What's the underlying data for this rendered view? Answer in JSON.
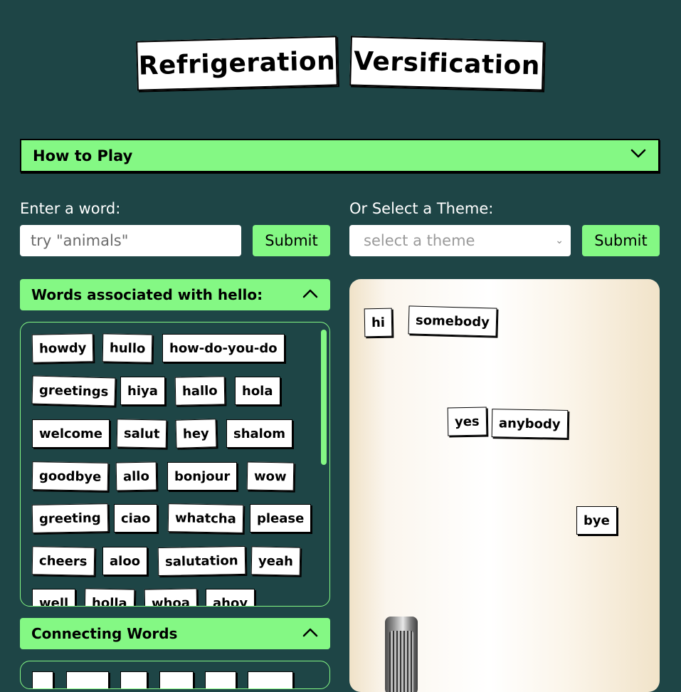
{
  "title": {
    "word1": "Refrigeration",
    "word2": "Versification"
  },
  "how_to_play": {
    "label": "How to Play",
    "icon": "chevron-down-icon"
  },
  "word_entry": {
    "label": "Enter a word:",
    "placeholder": "try \"animals\"",
    "submit": "Submit"
  },
  "theme_select": {
    "label": "Or Select a Theme:",
    "selected": "select a theme",
    "submit": "Submit"
  },
  "associated_panel": {
    "title": "Words associated with hello:",
    "icon": "chevron-up-icon",
    "words": [
      "howdy",
      "hullo",
      "how-do-you-do",
      "greetings",
      "hiya",
      "hallo",
      "hola",
      "welcome",
      "salut",
      "hey",
      "shalom",
      "goodbye",
      "allo",
      "bonjour",
      "wow",
      "greeting",
      "ciao",
      "whatcha",
      "please",
      "cheers",
      "aloo",
      "salutation",
      "yeah",
      "well",
      "holla",
      "whoa",
      "ahoy"
    ]
  },
  "connecting_panel": {
    "title": "Connecting Words",
    "icon": "chevron-up-icon"
  },
  "fridge": {
    "magnets": [
      "hi",
      "somebody",
      "yes",
      "anybody",
      "bye"
    ]
  },
  "colors": {
    "background": "#1e4546",
    "accent": "#84f884"
  }
}
